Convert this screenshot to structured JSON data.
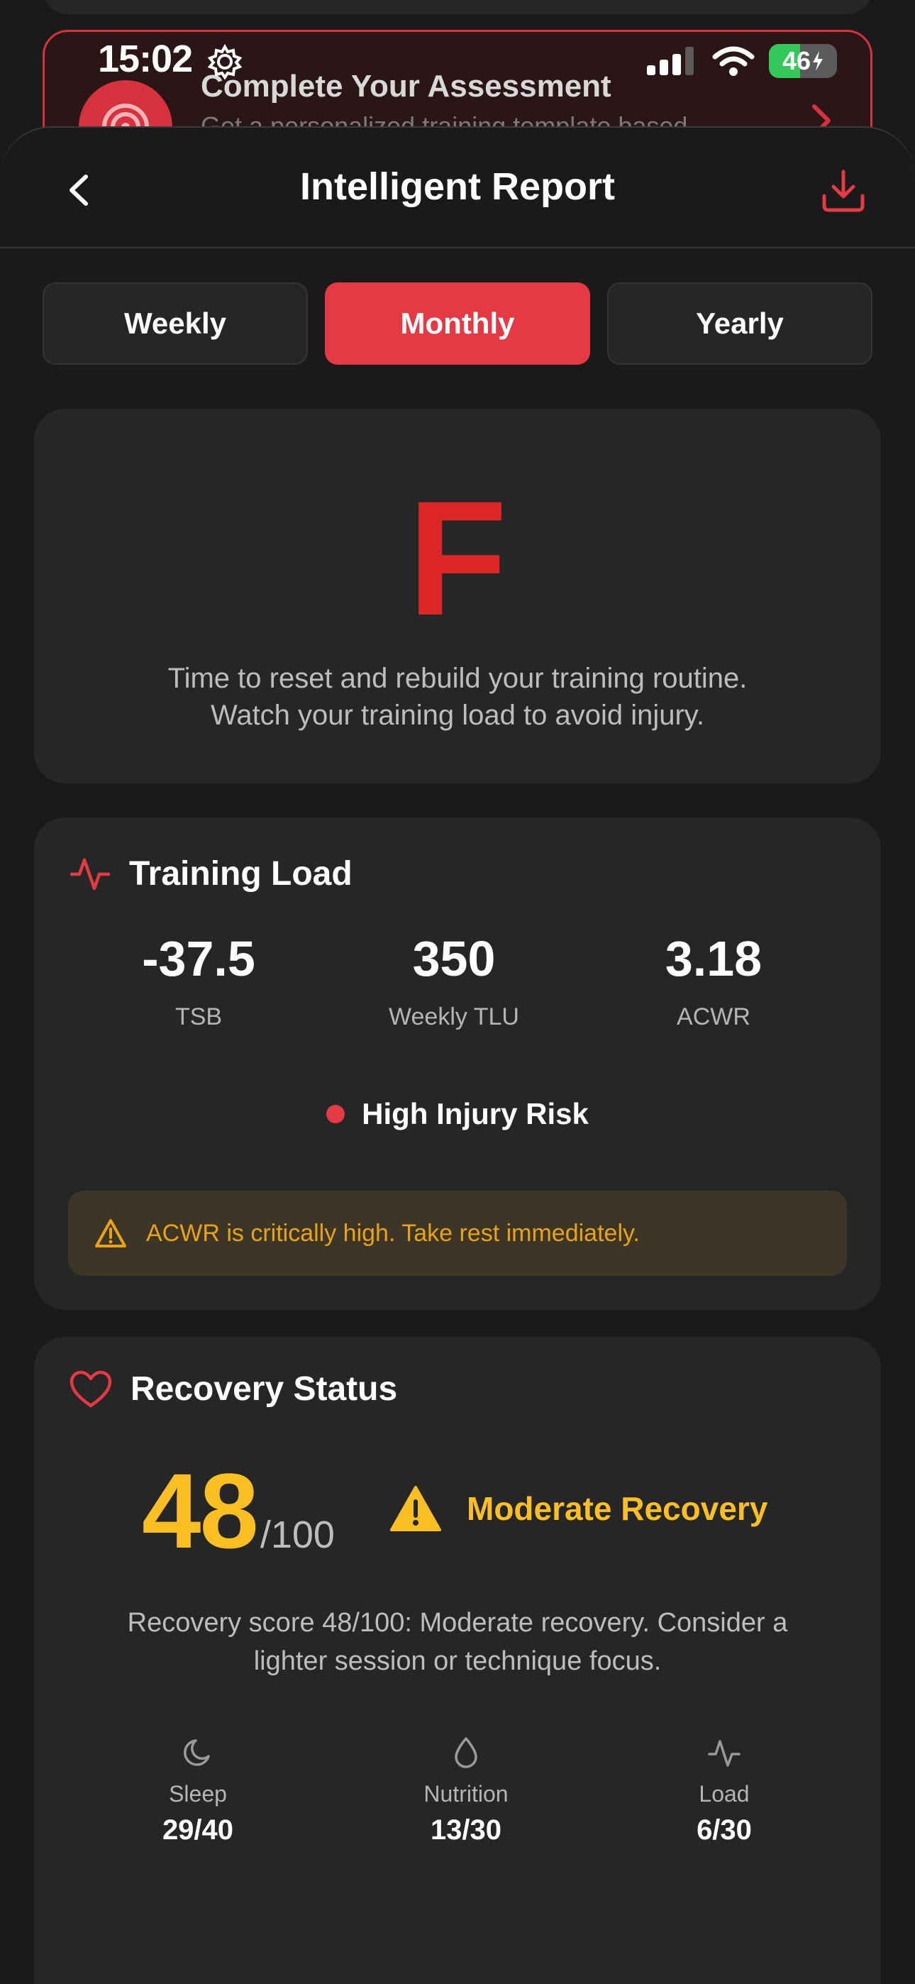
{
  "status_bar": {
    "time": "15:02",
    "battery": "46",
    "battery_level": 0.46
  },
  "background": {
    "assessment_title": "Complete Your Assessment",
    "assessment_subtitle": "Get a personalized training template based"
  },
  "nav": {
    "title": "Intelligent Report"
  },
  "period_tabs": {
    "tabs": [
      {
        "label": "Weekly",
        "active": false
      },
      {
        "label": "Monthly",
        "active": true
      },
      {
        "label": "Yearly",
        "active": false
      }
    ]
  },
  "grade_card": {
    "grade": "F",
    "message_line1": "Time to reset and rebuild your training routine.",
    "message_line2": "Watch your training load to avoid injury."
  },
  "training_load": {
    "title": "Training Load",
    "metrics": [
      {
        "value": "-37.5",
        "label": "TSB"
      },
      {
        "value": "350",
        "label": "Weekly TLU"
      },
      {
        "value": "3.18",
        "label": "ACWR"
      }
    ],
    "risk_label": "High Injury Risk",
    "alert": "ACWR is critically high. Take rest immediately."
  },
  "recovery": {
    "title": "Recovery Status",
    "score": "48",
    "score_max": "/100",
    "state": "Moderate Recovery",
    "description_line1": "Recovery score 48/100: Moderate recovery. Consider a",
    "description_line2": "lighter session or technique focus.",
    "factors": [
      {
        "icon": "moon-icon",
        "label": "Sleep",
        "value": "29/40"
      },
      {
        "icon": "droplet-icon",
        "label": "Nutrition",
        "value": "13/30"
      },
      {
        "icon": "pulse-icon",
        "label": "Load",
        "value": "6/30"
      }
    ]
  },
  "colors": {
    "accent": "#e63946",
    "grade": "#dc2626",
    "warning": "#fbbf24",
    "alert_text": "#e8a317",
    "card": "#262626",
    "background": "#1a1a1a"
  }
}
